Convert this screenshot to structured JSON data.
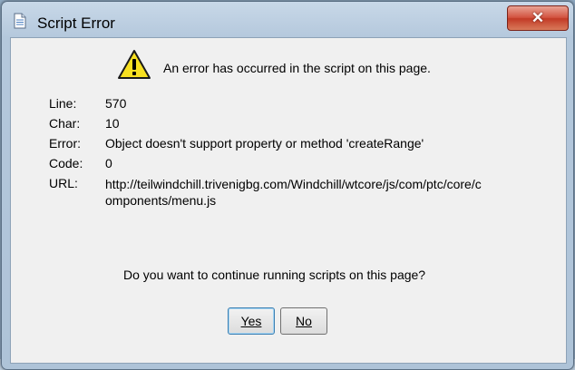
{
  "window": {
    "title": "Script Error",
    "close_label": "✕"
  },
  "message": "An error has occurred in the script on this page.",
  "details": {
    "line_label": "Line:",
    "line_value": "570",
    "char_label": "Char:",
    "char_value": "10",
    "error_label": "Error:",
    "error_value": "Object doesn't support property or method 'createRange'",
    "code_label": "Code:",
    "code_value": "0",
    "url_label": "URL:",
    "url_value": "http://teilwindchill.trivenigbg.com/Windchill/wtcore/js/com/ptc/core/components/menu.js"
  },
  "question": "Do you want to continue running scripts on this page?",
  "buttons": {
    "yes_label": "Yes",
    "no_label": "No"
  },
  "icons": {
    "title_icon": "document-icon",
    "warning_icon": "warning-icon"
  }
}
